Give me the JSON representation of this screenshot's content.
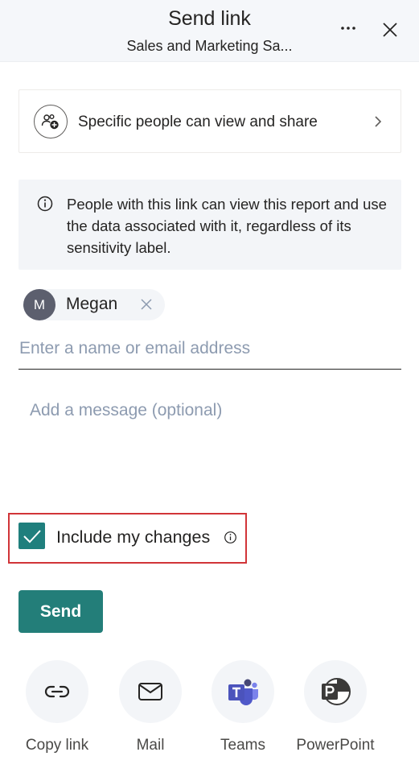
{
  "header": {
    "title": "Send link",
    "subtitle": "Sales and Marketing Sa...",
    "more_icon": "more-horizontal-icon",
    "close_icon": "close-icon"
  },
  "permission": {
    "label": "Specific people can view and share",
    "icon": "people-add-icon",
    "chevron_icon": "chevron-right-icon"
  },
  "info": {
    "icon": "info-icon",
    "text": "People with this link can view this report and use the data associated with it, regardless of its sensitivity label."
  },
  "recipient": {
    "initial": "M",
    "name": "Megan",
    "remove_icon": "dismiss-icon"
  },
  "email_input": {
    "value": "",
    "placeholder": "Enter a name or email address"
  },
  "message_input": {
    "value": "",
    "placeholder": "Add a message (optional)"
  },
  "include_changes": {
    "label": "Include my changes",
    "checked": true,
    "info_icon": "info-icon"
  },
  "send": {
    "label": "Send"
  },
  "share_options": [
    {
      "label": "Copy link",
      "icon": "link-icon"
    },
    {
      "label": "Mail",
      "icon": "mail-icon"
    },
    {
      "label": "Teams",
      "icon": "teams-icon"
    },
    {
      "label": "PowerPoint",
      "icon": "powerpoint-icon"
    }
  ],
  "colors": {
    "accent": "#237e79",
    "checkbox": "#1f7f7d",
    "highlight_border": "#d13438",
    "header_bg": "#f5f7fa",
    "info_bg": "#f3f5f8",
    "avatar_bg": "#5c5f6e",
    "placeholder": "#8d9bb0"
  }
}
